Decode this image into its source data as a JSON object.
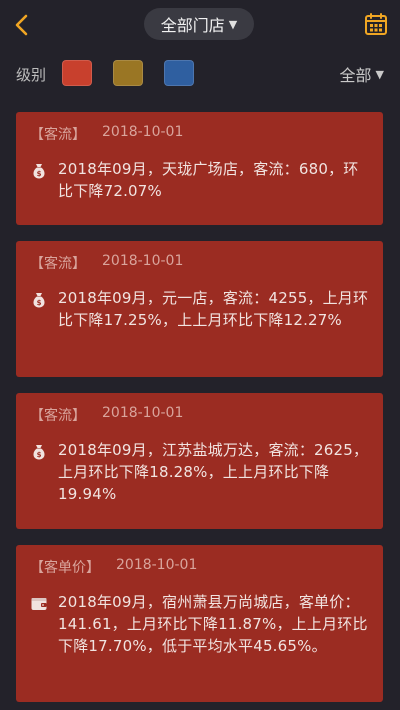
{
  "header": {
    "store_selector": "全部门店"
  },
  "filter": {
    "level_label": "级别",
    "swatches": [
      {
        "name": "red",
        "color": "#c8402d"
      },
      {
        "name": "gold",
        "color": "#9a7624"
      },
      {
        "name": "blue",
        "color": "#2f5fa0"
      }
    ],
    "all_label": "全部"
  },
  "cards": [
    {
      "tag": "【客流】",
      "date": "2018-10-01",
      "icon": "money-bag-icon",
      "text": "2018年09月，天珑广场店，客流：680，环比下降72.07%"
    },
    {
      "tag": "【客流】",
      "date": "2018-10-01",
      "icon": "money-bag-icon",
      "text": "2018年09月，元一店，客流：4255，上月环比下降17.25%，上上月环比下降12.27%"
    },
    {
      "tag": "【客流】",
      "date": "2018-10-01",
      "icon": "money-bag-icon",
      "text": "2018年09月，江苏盐城万达，客流：2625，上月环比下降18.28%，上上月环比下降19.94%"
    },
    {
      "tag": "【客单价】",
      "date": "2018-10-01",
      "icon": "wallet-icon",
      "text": "2018年09月，宿州萧县万尚城店，客单价：141.61，上月环比下降11.87%，上上月环比下降17.70%，低于平均水平45.65%。"
    }
  ],
  "colors": {
    "background": "#23222a",
    "card": "#9b2c22",
    "accent": "#f0a623"
  }
}
